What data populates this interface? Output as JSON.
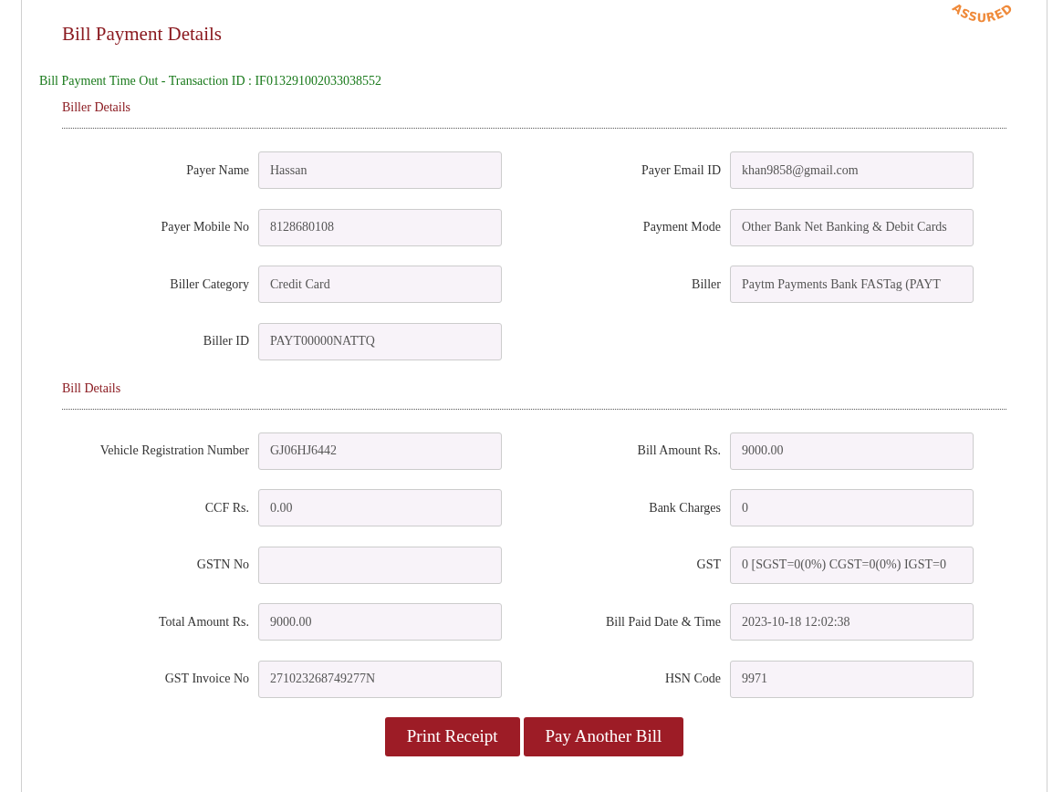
{
  "stamp": {
    "text": "ASSURED"
  },
  "page": {
    "title": "Bill Payment Details",
    "status_message": "Bill Payment Time Out - Transaction ID : IF013291002033038552"
  },
  "sections": [
    {
      "title": "Biller Details",
      "fields": [
        {
          "label": "Payer Name",
          "value": "Hassan"
        },
        {
          "label": "Payer Email ID",
          "value": "khan9858@gmail.com"
        },
        {
          "label": "Payer Mobile No",
          "value": "8128680108"
        },
        {
          "label": "Payment Mode",
          "value": "Other Bank Net Banking & Debit Cards"
        },
        {
          "label": "Biller Category",
          "value": "Credit Card"
        },
        {
          "label": "Biller",
          "value": "Paytm Payments Bank FASTag (PAYT"
        },
        {
          "label": "Biller ID",
          "value": "PAYT00000NATTQ"
        }
      ]
    },
    {
      "title": "Bill Details",
      "fields": [
        {
          "label": "Vehicle Registration Number",
          "value": "GJ06HJ6442"
        },
        {
          "label": "Bill Amount Rs.",
          "value": "9000.00"
        },
        {
          "label": "CCF Rs.",
          "value": "0.00"
        },
        {
          "label": "Bank Charges",
          "value": "0"
        },
        {
          "label": "GSTN No"
        },
        {
          "label": "GST",
          "value": "0 [SGST=0(0%) CGST=0(0%) IGST=0"
        },
        {
          "label": "Total Amount Rs.",
          "value": "9000.00"
        },
        {
          "label": "Bill Paid Date & Time",
          "value": "2023-10-18 12:02:38"
        },
        {
          "label": "GST Invoice No",
          "value": "271023268749277N"
        },
        {
          "label": "HSN Code",
          "value": "9971"
        }
      ]
    }
  ],
  "buttons": [
    {
      "label": "Print Receipt"
    },
    {
      "label": "Pay Another Bill"
    }
  ]
}
